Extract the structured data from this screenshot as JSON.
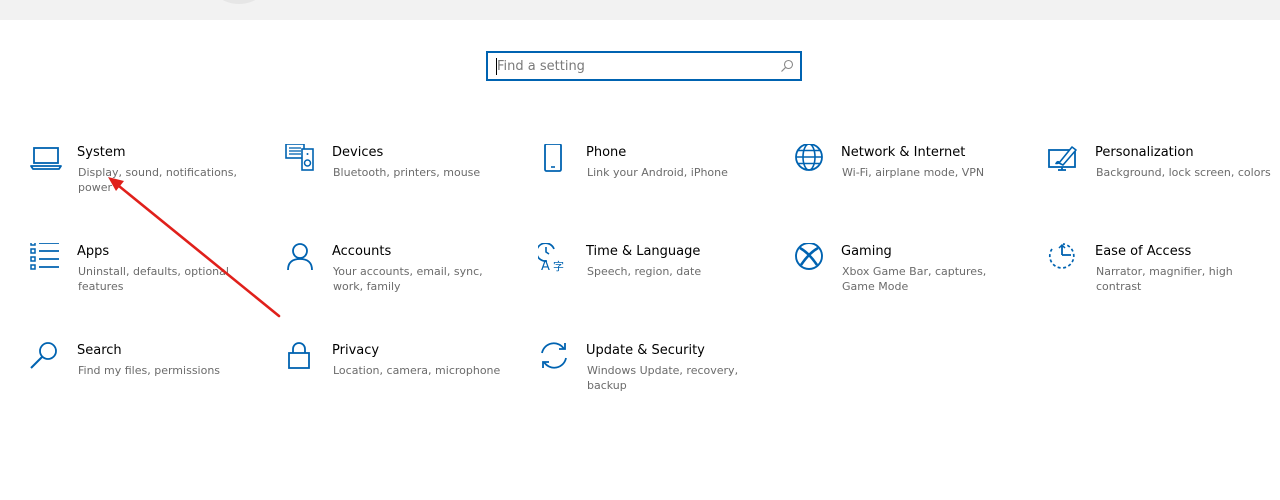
{
  "search": {
    "placeholder": "Find a setting"
  },
  "tiles": [
    {
      "title": "System",
      "desc": "Display, sound, notifications, power"
    },
    {
      "title": "Devices",
      "desc": "Bluetooth, printers, mouse"
    },
    {
      "title": "Phone",
      "desc": "Link your Android, iPhone"
    },
    {
      "title": "Network & Internet",
      "desc": "Wi-Fi, airplane mode, VPN"
    },
    {
      "title": "Personalization",
      "desc": "Background, lock screen, colors"
    },
    {
      "title": "Apps",
      "desc": "Uninstall, defaults, optional features"
    },
    {
      "title": "Accounts",
      "desc": "Your accounts, email, sync, work, family"
    },
    {
      "title": "Time & Language",
      "desc": "Speech, region, date"
    },
    {
      "title": "Gaming",
      "desc": "Xbox Game Bar, captures, Game Mode"
    },
    {
      "title": "Ease of Access",
      "desc": "Narrator, magnifier, high contrast"
    },
    {
      "title": "Search",
      "desc": "Find my files, permissions"
    },
    {
      "title": "Privacy",
      "desc": "Location, camera, microphone"
    },
    {
      "title": "Update & Security",
      "desc": "Windows Update, recovery, backup"
    }
  ],
  "colors": {
    "accent": "#0063b1",
    "annotation_arrow": "#e0201b"
  }
}
